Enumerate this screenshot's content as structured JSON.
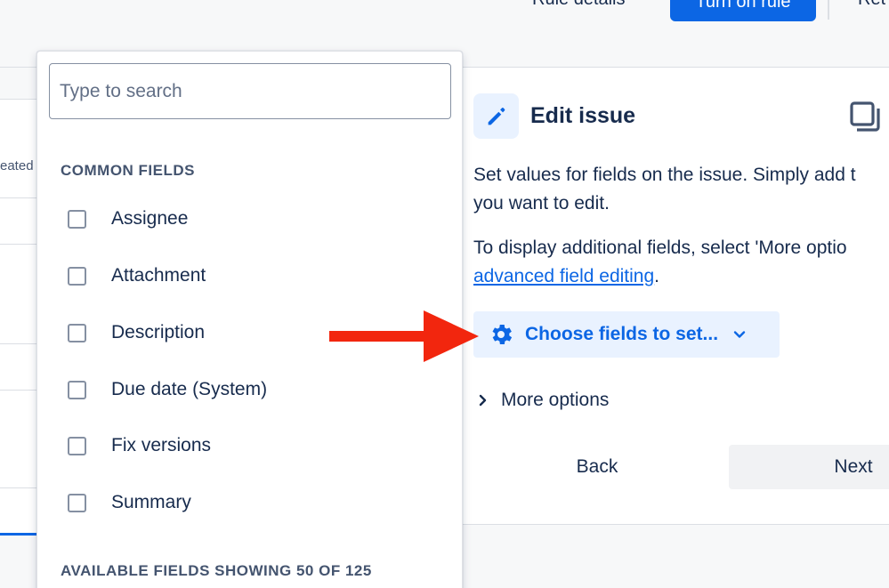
{
  "topbar": {
    "rule_details_label": "Rule details",
    "turn_on_label": "Turn on rule",
    "return_label": "Ret"
  },
  "background_list": {
    "column_label": "eated"
  },
  "dropdown": {
    "search_placeholder": "Type to search",
    "common_heading": "COMMON FIELDS",
    "common_fields": [
      "Assignee",
      "Attachment",
      "Description",
      "Due date (System)",
      "Fix versions",
      "Summary"
    ],
    "available_heading": "AVAILABLE FIELDS SHOWING 50 OF 125"
  },
  "panel": {
    "title": "Edit issue",
    "description_line1": "Set values for fields on the issue. Simply add t",
    "description_line2": "you want to edit.",
    "additional_line1": "To display additional fields, select 'More optio",
    "additional_link": "advanced field editing",
    "additional_suffix": ".",
    "choose_fields_label": "Choose fields to set...",
    "more_options_label": "More options",
    "back_label": "Back",
    "next_label": "Next"
  },
  "icons": {
    "edit": "pencil-icon",
    "copy": "copy-icon",
    "gear": "gear-icon",
    "chevron_down": "chevron-down-icon",
    "chevron_right": "chevron-right-icon"
  },
  "colors": {
    "accent": "#0c66e4",
    "accent_light": "#e9f2ff",
    "annotation_arrow": "#f2260e",
    "text": "#172b4d"
  }
}
